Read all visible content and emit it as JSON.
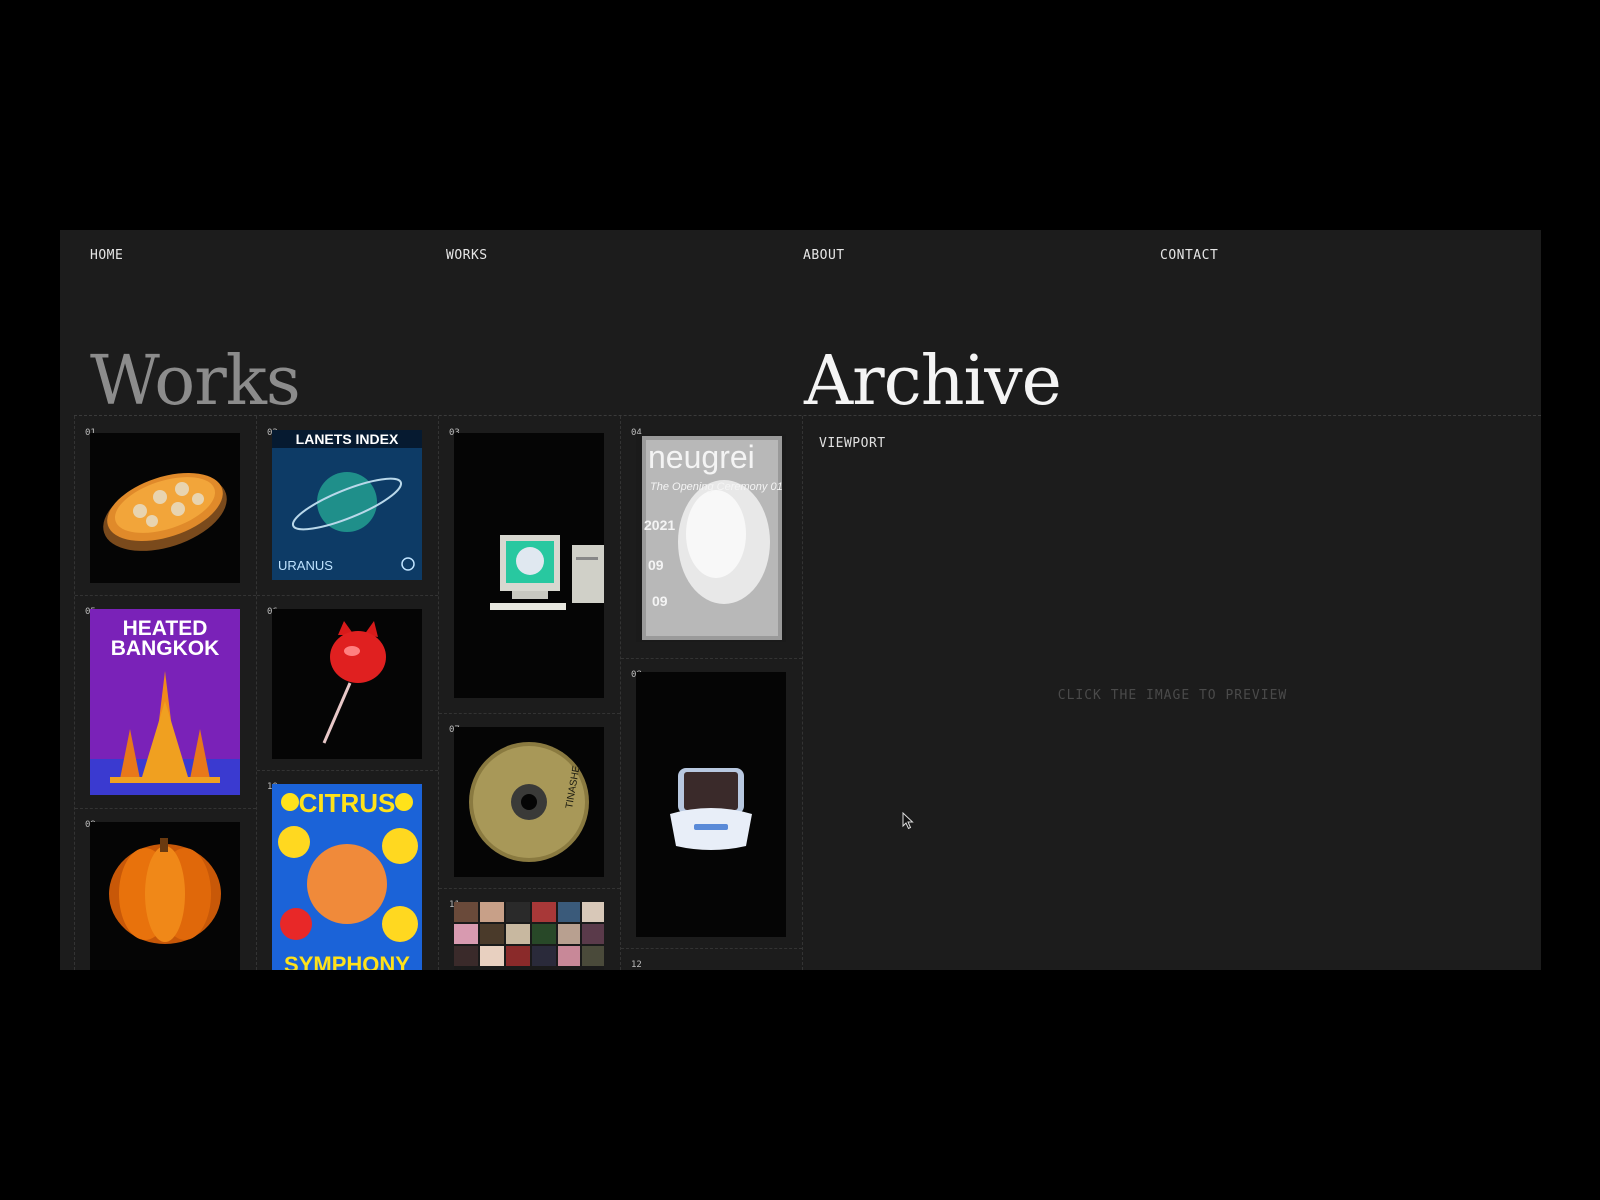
{
  "nav": {
    "home": "HOME",
    "works": "WORKS",
    "about": "ABOUT",
    "contact": "CONTACT"
  },
  "header": {
    "title_left": "Works",
    "title_right": "Archive"
  },
  "viewport": {
    "label": "VIEWPORT",
    "hint": "CLICK THE IMAGE TO PREVIEW"
  },
  "items": [
    {
      "num": "01",
      "subject": "pie"
    },
    {
      "num": "02",
      "subject": "planets-index-poster",
      "text_top": "LANETS INDEX",
      "text_bottom": "URANUS"
    },
    {
      "num": "03",
      "subject": "retro-computer"
    },
    {
      "num": "04",
      "subject": "neugrei-poster",
      "text_top": "neugrei",
      "text_mid": "The Opening Ceremony 01",
      "year": "2021",
      "d1": "09",
      "d2": "09"
    },
    {
      "num": "05",
      "subject": "heated-bangkok-poster",
      "text_top": "HEATED",
      "text_bottom": "BANGKOK"
    },
    {
      "num": "06",
      "subject": "cat-lollipop"
    },
    {
      "num": "07",
      "subject": "cd-disc",
      "text": "TINASHE"
    },
    {
      "num": "08",
      "subject": "ibook-laptop"
    },
    {
      "num": "09",
      "subject": "pumpkin"
    },
    {
      "num": "10",
      "subject": "citrus-symphony-poster",
      "text_top": "CITRUS",
      "text_bottom": "SYMPHONY"
    },
    {
      "num": "11",
      "subject": "photo-collage"
    },
    {
      "num": "12",
      "subject": "partial"
    }
  ],
  "colors": {
    "page": "#000000",
    "frame": "#1c1c1c",
    "title_muted": "#8c8c8c",
    "title_bright": "#f4f4f4",
    "purple": "#7a22b8",
    "blue": "#1b63d8",
    "orange": "#f08a1c"
  }
}
